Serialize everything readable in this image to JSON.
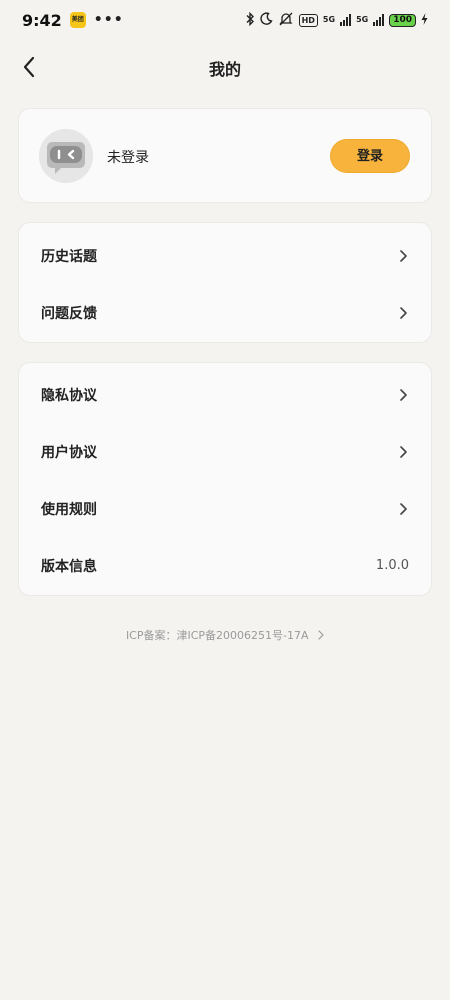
{
  "status_bar": {
    "time": "9:42",
    "app_badge": "美团",
    "dots": "•••",
    "hd": "HD",
    "network1": "5G",
    "network2": "5G",
    "battery": "100"
  },
  "navbar": {
    "title": "我的"
  },
  "profile": {
    "name": "未登录",
    "login_label": "登录"
  },
  "menu_group_1": [
    {
      "label": "历史话题"
    },
    {
      "label": "问题反馈"
    }
  ],
  "menu_group_2": [
    {
      "label": "隐私协议"
    },
    {
      "label": "用户协议"
    },
    {
      "label": "使用规则"
    },
    {
      "label": "版本信息",
      "value": "1.0.0"
    }
  ],
  "footer": {
    "icp": "ICP备案：津ICP备20006251号-17A"
  },
  "colors": {
    "background": "#f4f3f0",
    "card": "#fafafa",
    "accent": "#f7b33b"
  }
}
